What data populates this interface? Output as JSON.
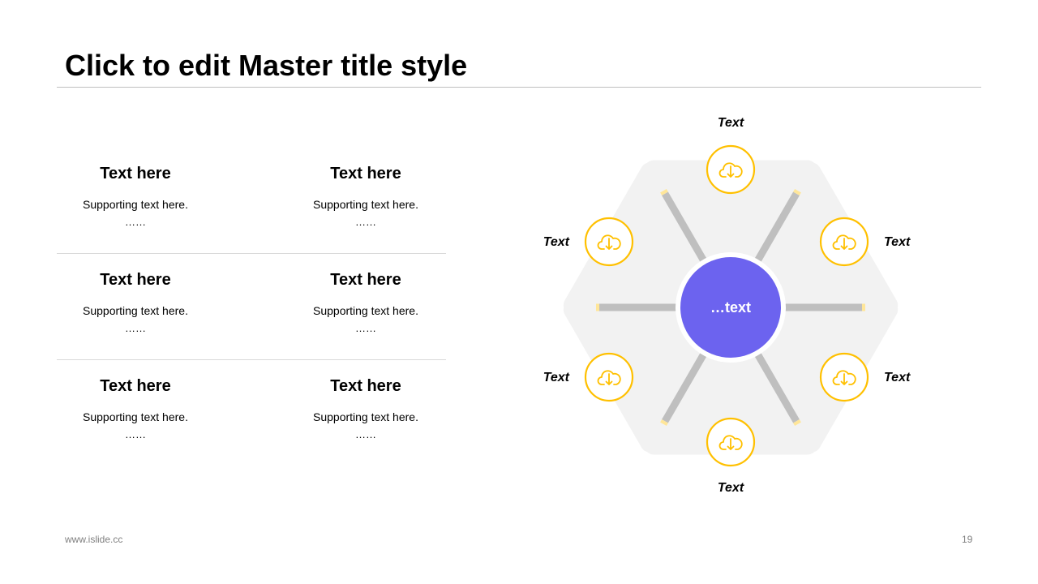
{
  "slide": {
    "title": "Click to edit Master title style",
    "footer_url": "www.islide.cc",
    "page_number": "19"
  },
  "items": [
    {
      "heading": "Text here",
      "supporting": "Supporting text here.",
      "dots": "……"
    },
    {
      "heading": "Text here",
      "supporting": "Supporting text here.",
      "dots": "……"
    },
    {
      "heading": "Text here",
      "supporting": "Supporting text here.",
      "dots": "……"
    },
    {
      "heading": "Text here",
      "supporting": "Supporting text here.",
      "dots": "……"
    },
    {
      "heading": "Text here",
      "supporting": "Supporting text here.",
      "dots": "……"
    },
    {
      "heading": "Text here",
      "supporting": "Supporting text here.",
      "dots": "……"
    }
  ],
  "diagram": {
    "center_label": "…text",
    "node_labels": [
      "Text",
      "Text",
      "Text",
      "Text",
      "Text",
      "Text"
    ],
    "node_icon": "cloud-download-icon",
    "colors": {
      "center": "#6c63ef",
      "accent": "#ffc000",
      "segment": "#f2f2f2",
      "spoke": "#bfbfbf"
    }
  }
}
